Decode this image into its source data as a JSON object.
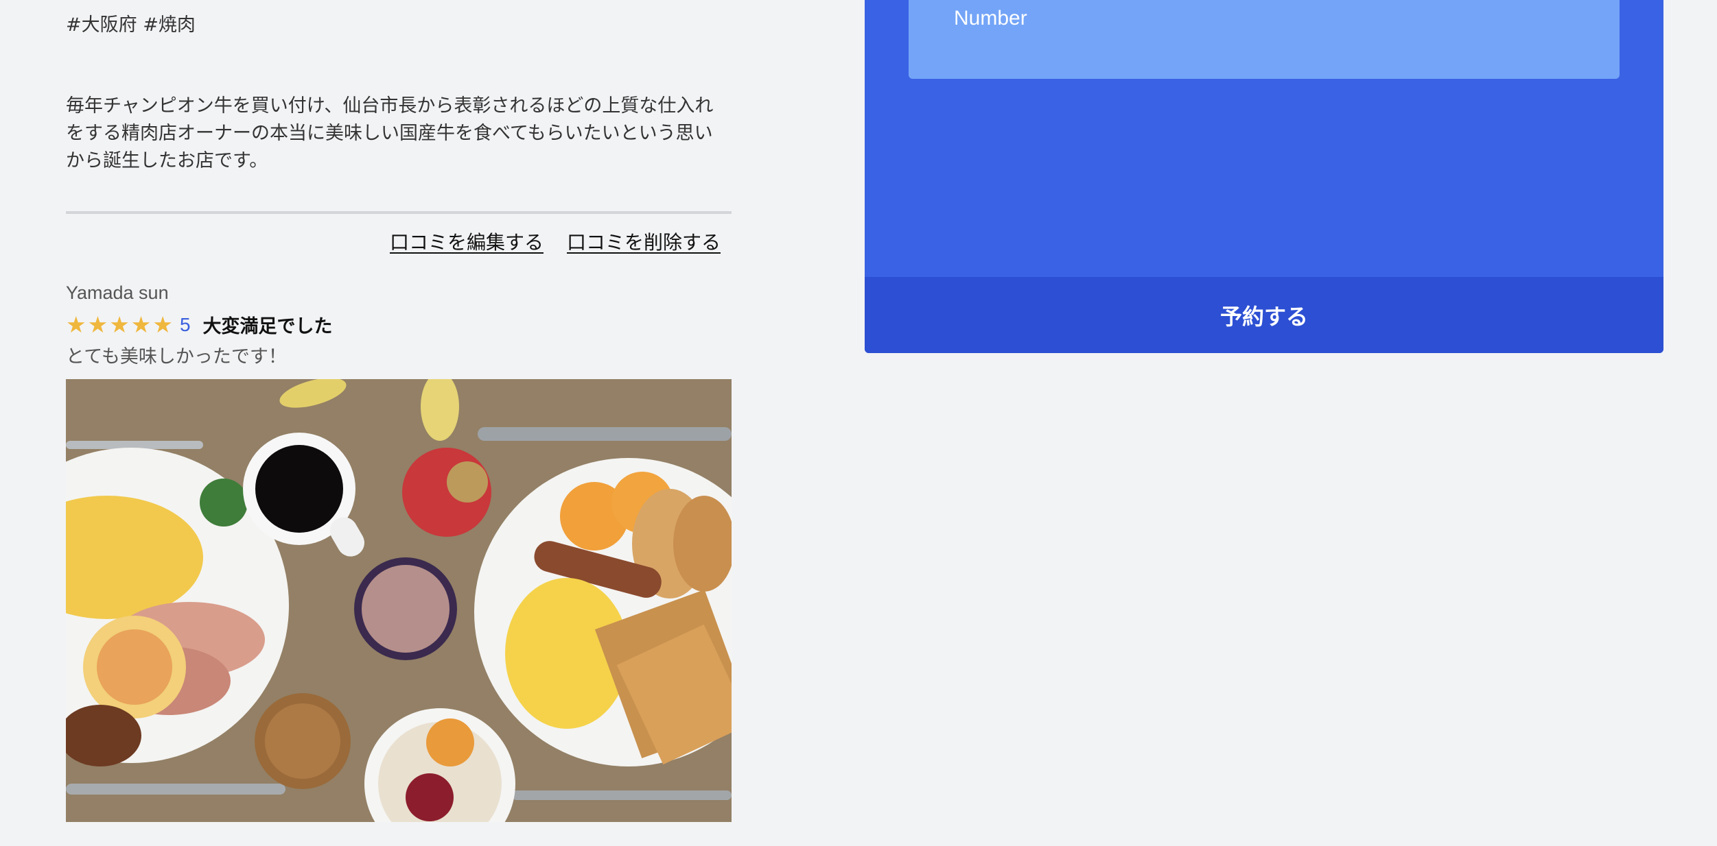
{
  "shop": {
    "tags": "#大阪府 #焼肉",
    "description": "毎年チャンピオン牛を買い付け、仙台市長から表彰されるほどの上質な仕入れをする精肉店オーナーの本当に美味しい国産牛を食べてもらいたいという思いから誕生したお店です。"
  },
  "review_actions": {
    "edit_label": "口コミを編集する",
    "delete_label": "口コミを削除する"
  },
  "review": {
    "reviewer": "Yamada sun",
    "stars": [
      "★",
      "★",
      "★",
      "★",
      "★"
    ],
    "rating": "5",
    "rating_value": 5,
    "rating_max": 5,
    "title": "大変満足でした",
    "body": "とても美味しかったです！"
  },
  "reservation": {
    "number_field_value": "Number",
    "submit_label": "予約する"
  },
  "colors": {
    "page_bg": "#f2f3f5",
    "card_bg": "#3a62e4",
    "field_bg": "#73a4f7",
    "button_bg": "#2c4fd3",
    "star": "#efb73e",
    "score": "#3a5fde"
  },
  "icons": {
    "star": "star-icon"
  }
}
